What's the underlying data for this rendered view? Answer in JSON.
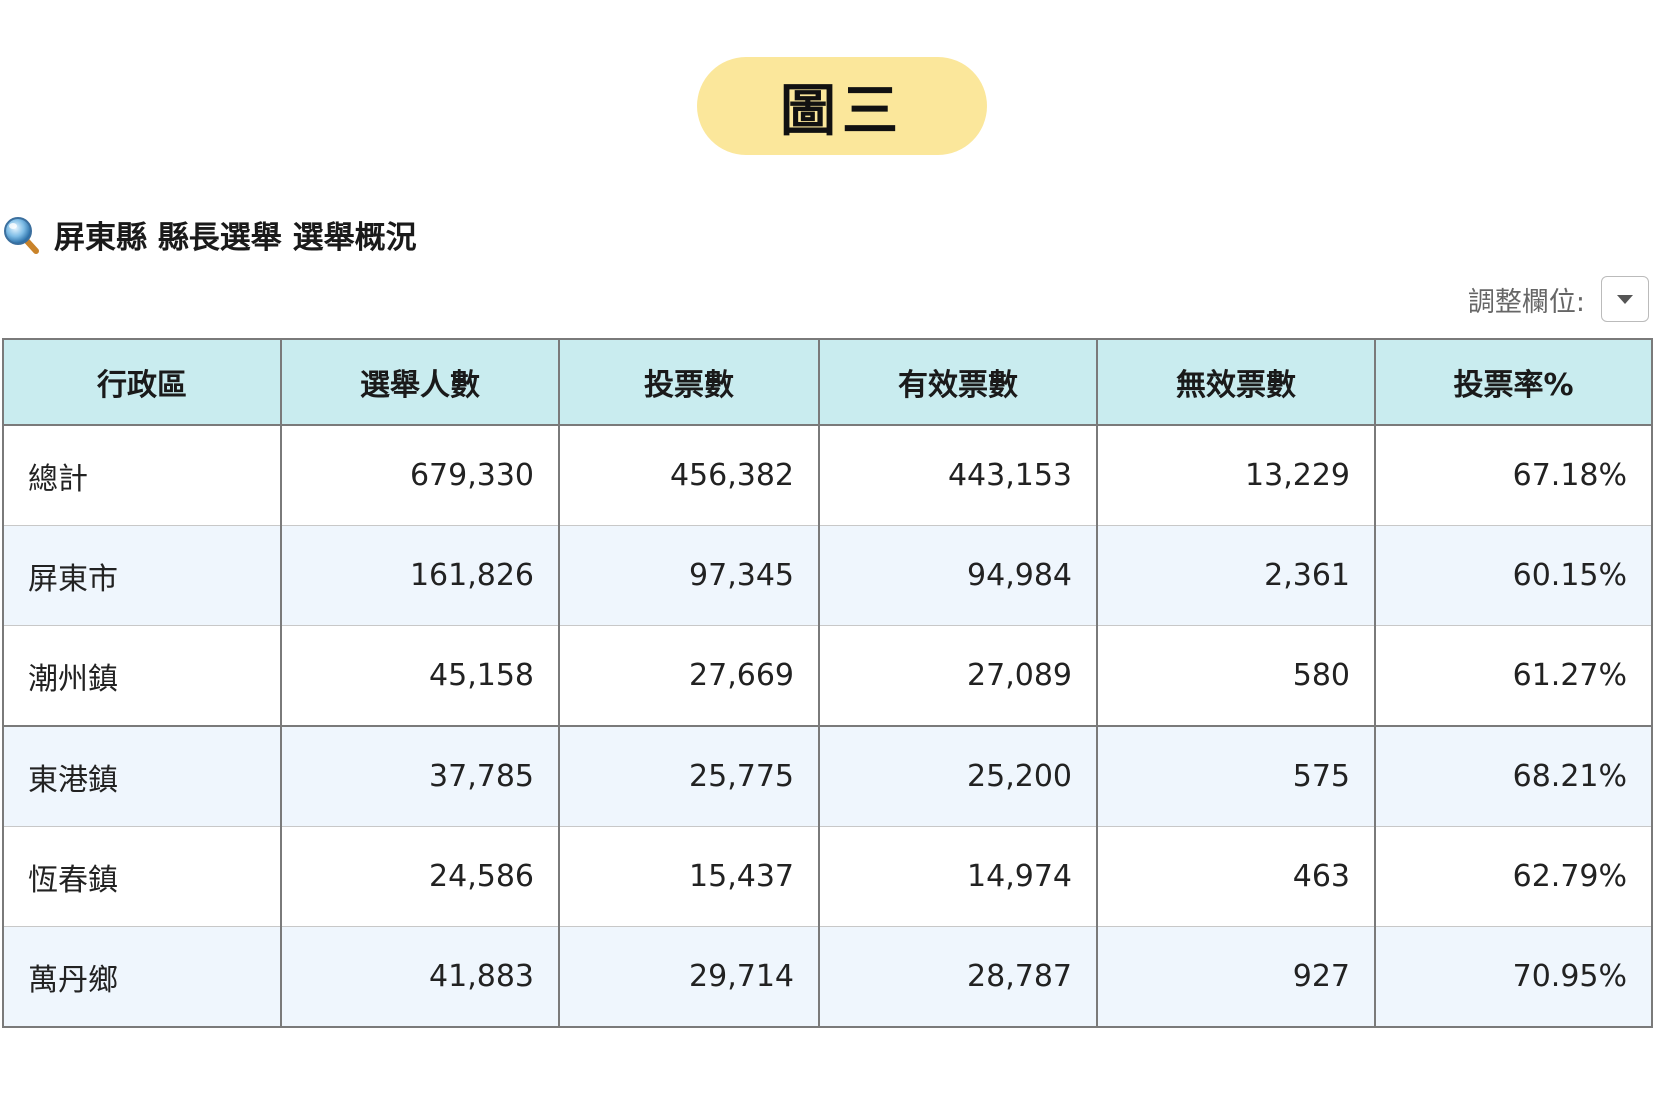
{
  "badge": {
    "label": "圖三"
  },
  "section": {
    "icon": "magnifier-icon",
    "title": "屏東縣 縣長選舉 選舉概況"
  },
  "column_adjust": {
    "label": "調整欄位:",
    "icon": "caret-down-icon"
  },
  "table": {
    "headers": [
      "行政區",
      "選舉人數",
      "投票數",
      "有效票數",
      "無效票數",
      "投票率%"
    ],
    "rows": [
      {
        "name": "總計",
        "electors": "679,330",
        "votes": "456,382",
        "valid": "443,153",
        "invalid": "13,229",
        "rate": "67.18%"
      },
      {
        "name": "屏東市",
        "electors": "161,826",
        "votes": "97,345",
        "valid": "94,984",
        "invalid": "2,361",
        "rate": "60.15%"
      },
      {
        "name": "潮州鎮",
        "electors": "45,158",
        "votes": "27,669",
        "valid": "27,089",
        "invalid": "580",
        "rate": "61.27%"
      },
      {
        "name": "東港鎮",
        "electors": "37,785",
        "votes": "25,775",
        "valid": "25,200",
        "invalid": "575",
        "rate": "68.21%"
      },
      {
        "name": "恆春鎮",
        "electors": "24,586",
        "votes": "15,437",
        "valid": "14,974",
        "invalid": "463",
        "rate": "62.79%"
      },
      {
        "name": "萬丹鄉",
        "electors": "41,883",
        "votes": "29,714",
        "valid": "28,787",
        "invalid": "927",
        "rate": "70.95%"
      }
    ]
  },
  "colors": {
    "badge_bg": "#fbe79b",
    "header_bg": "#c9ecef",
    "alt_row_bg": "#eff6fd",
    "border": "#7a7a7a"
  }
}
